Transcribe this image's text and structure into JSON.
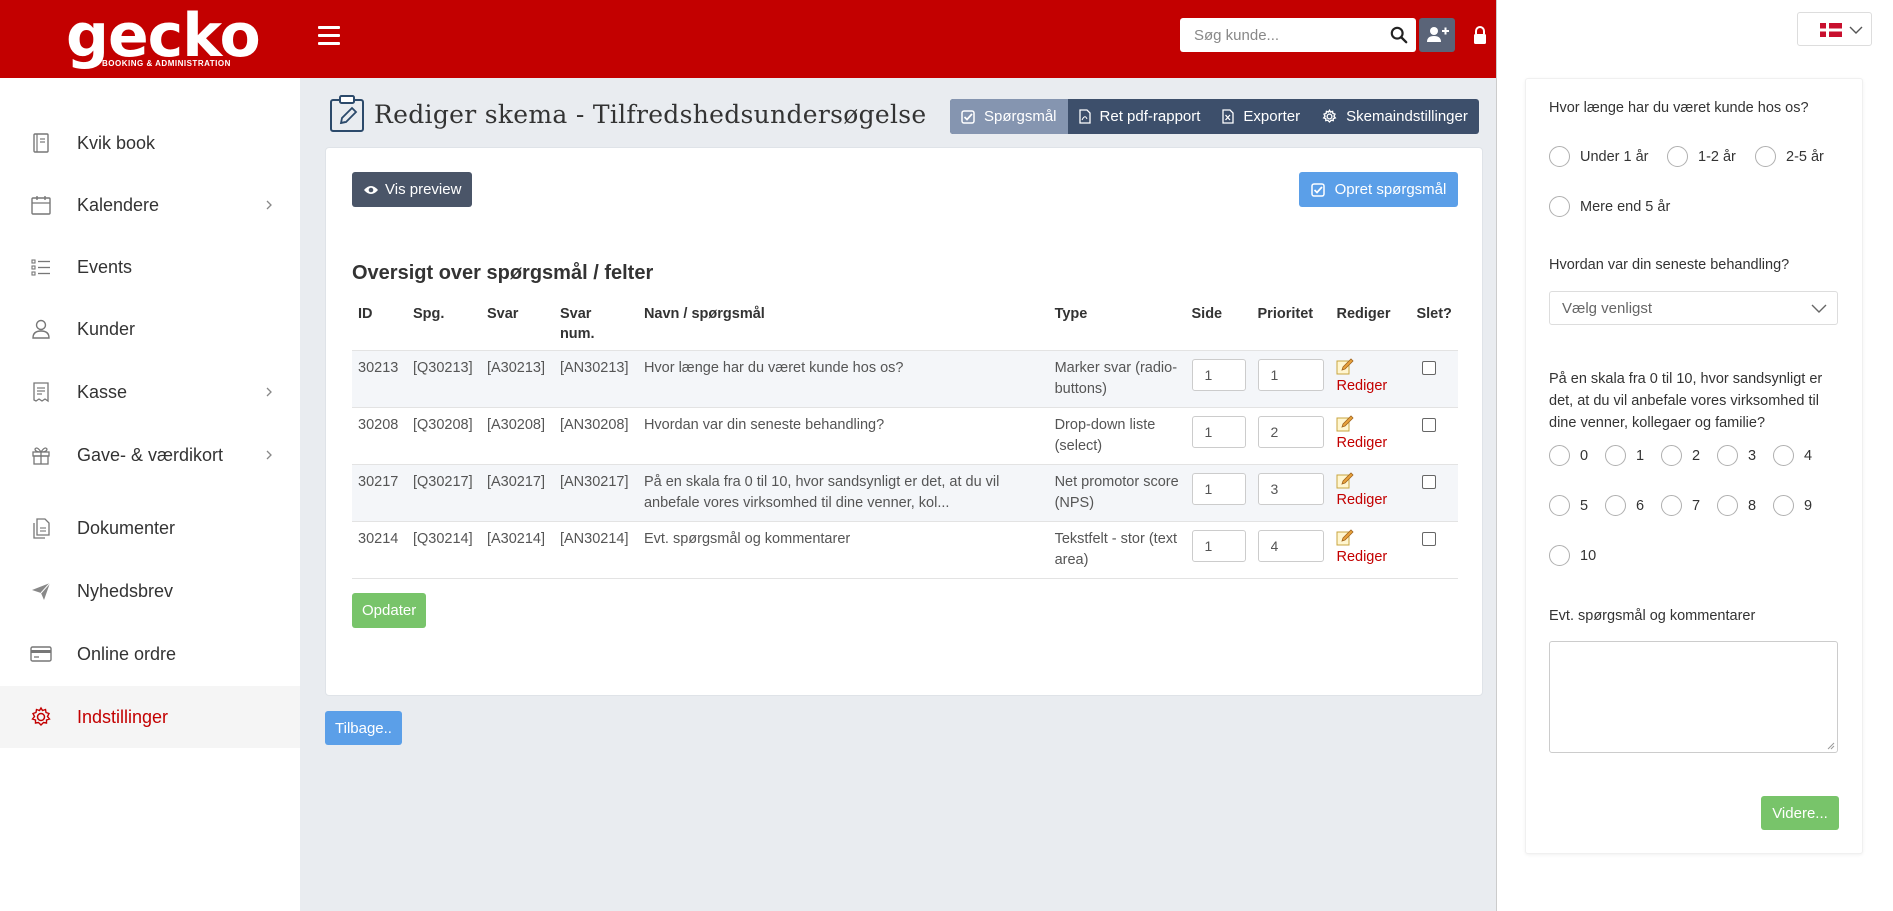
{
  "header": {
    "logo_text": "gecko",
    "logo_tagline": "BOOKING & ADMINISTRATION",
    "search_placeholder": "Søg kunde...",
    "brand_color": "#c30000"
  },
  "sidebar": {
    "items": [
      {
        "label": "Kvik book",
        "icon": "book-icon"
      },
      {
        "label": "Kalendere",
        "icon": "calendar-icon",
        "has_submenu": true
      },
      {
        "label": "Events",
        "icon": "list-icon"
      },
      {
        "label": "Kunder",
        "icon": "user-icon"
      },
      {
        "label": "Kasse",
        "icon": "receipt-icon",
        "has_submenu": true
      },
      {
        "label": "Gave- & værdikort",
        "icon": "gift-icon",
        "has_submenu": true
      },
      {
        "label": "Dokumenter",
        "icon": "documents-icon"
      },
      {
        "label": "Nyhedsbrev",
        "icon": "paper-plane-icon"
      },
      {
        "label": "Online ordre",
        "icon": "credit-card-icon"
      },
      {
        "label": "Indstillinger",
        "icon": "gear-icon",
        "active": true
      }
    ]
  },
  "page": {
    "title": "Rediger skema - Tilfredshedsundersøgelse",
    "tabs": [
      {
        "label": "Spørgsmål",
        "icon": "checkbox-icon",
        "active": true
      },
      {
        "label": "Ret pdf-rapport",
        "icon": "pdf-icon"
      },
      {
        "label": "Exporter",
        "icon": "excel-icon"
      },
      {
        "label": "Skemaindstillinger",
        "icon": "gear-icon"
      }
    ],
    "preview_button": "Vis preview",
    "create_button": "Opret spørgsmål",
    "section_title": "Oversigt over spørgsmål / felter",
    "update_button": "Opdater",
    "back_button": "Tilbage.."
  },
  "table": {
    "headers": {
      "id": "ID",
      "spg": "Spg.",
      "svar": "Svar",
      "svar_num_1": "Svar",
      "svar_num_2": "num.",
      "navn": "Navn / spørgsmål",
      "type": "Type",
      "side": "Side",
      "prioritet": "Prioritet",
      "rediger": "Rediger",
      "slet": "Slet?"
    },
    "edit_label": "Rediger",
    "rows": [
      {
        "id": "30213",
        "spg": "[Q30213]",
        "svar": "[A30213]",
        "svar_num": "[AN30213]",
        "name": "Hvor længe har du været kunde hos os?",
        "type": "Marker svar (radio-buttons)",
        "side": "1",
        "prioritet": "1"
      },
      {
        "id": "30208",
        "spg": "[Q30208]",
        "svar": "[A30208]",
        "svar_num": "[AN30208]",
        "name": "Hvordan var din seneste behandling?",
        "type": "Drop-down liste (select)",
        "side": "1",
        "prioritet": "2"
      },
      {
        "id": "30217",
        "spg": "[Q30217]",
        "svar": "[A30217]",
        "svar_num": "[AN30217]",
        "name": "På en skala fra 0 til 10, hvor sandsynligt er det, at du vil anbefale vores virksomhed til dine venner, kol...",
        "type": "Net promotor score (NPS)",
        "side": "1",
        "prioritet": "3"
      },
      {
        "id": "30214",
        "spg": "[Q30214]",
        "svar": "[A30214]",
        "svar_num": "[AN30214]",
        "name": "Evt. spørgsmål og kommentarer",
        "type": "Tekstfelt - stor (text area)",
        "side": "1",
        "prioritet": "4"
      }
    ]
  },
  "preview": {
    "language_flag": "danish-flag-icon",
    "q1": {
      "label": "Hvor længe har du været kunde hos os?",
      "options": [
        "Under 1 år",
        "1-2 år",
        "2-5 år",
        "Mere end 5 år"
      ]
    },
    "q2": {
      "label": "Hvordan var din seneste behandling?",
      "placeholder": "Vælg venligst"
    },
    "q3": {
      "label": "På en skala fra 0 til 10, hvor sandsynligt er det, at du vil anbefale vores virksomhed til dine venner, kollegaer og familie?",
      "options": [
        "0",
        "1",
        "2",
        "3",
        "4",
        "5",
        "6",
        "7",
        "8",
        "9",
        "10"
      ]
    },
    "q4": {
      "label": "Evt. spørgsmål og kommentarer"
    },
    "next_button": "Videre..."
  }
}
